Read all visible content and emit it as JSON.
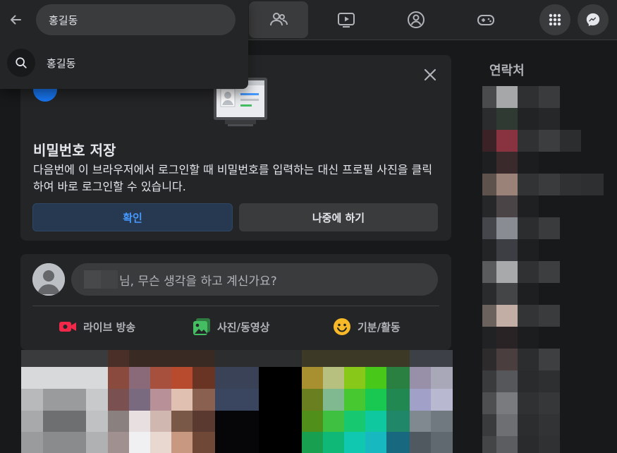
{
  "search": {
    "value": "홍길동",
    "suggestion": "홍길동"
  },
  "save_password": {
    "title": "비밀번호 저장",
    "description": "다음번에 이 브라우저에서 로그인할 때 비밀번호를 입력하는 대신 프로필 사진을 클릭하여 바로 로그인할 수 있습니다.",
    "confirm_label": "확인",
    "later_label": "나중에 하기"
  },
  "composer": {
    "prompt": "님, 무슨 생각을 하고 계신가요?",
    "actions": [
      {
        "label": "라이브 방송",
        "icon": "live-video-icon",
        "color": "#f02849"
      },
      {
        "label": "사진/동영상",
        "icon": "photo-video-icon",
        "color": "#45bd62"
      },
      {
        "label": "기분/활동",
        "icon": "feeling-icon",
        "color": "#f7b928"
      }
    ]
  },
  "contacts": {
    "title": "연락처"
  },
  "colors": {
    "background": "#18191a",
    "surface": "#242526",
    "accent": "#2d88ff",
    "text_primary": "#e4e6eb",
    "text_secondary": "#b0b3b8"
  }
}
